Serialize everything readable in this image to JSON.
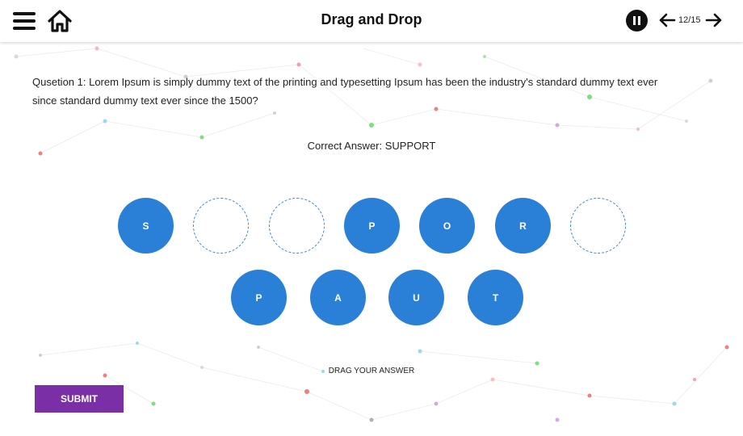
{
  "header": {
    "title": "Drag and Drop",
    "page_counter": "12/15"
  },
  "question": {
    "text": "Qusetion 1: Lorem Ipsum is simply dummy text of the printing and typesetting Ipsum has been the industry's standard dummy text ever since standard dummy text ever since the 1500?",
    "correct_answer": "Correct Answer: SUPPORT"
  },
  "answer_slots": [
    {
      "letter": "S",
      "filled": true
    },
    {
      "letter": "",
      "filled": false
    },
    {
      "letter": "",
      "filled": false
    },
    {
      "letter": "P",
      "filled": true
    },
    {
      "letter": "O",
      "filled": true
    },
    {
      "letter": "R",
      "filled": true
    },
    {
      "letter": "",
      "filled": false
    }
  ],
  "letter_tiles": [
    "P",
    "A",
    "U",
    "T"
  ],
  "drag_hint": "DRAG YOUR ANSWER",
  "submit_label": "SUBMIT",
  "colors": {
    "tile_blue": "#2a7fd6",
    "submit_purple": "#7b2fa6",
    "pause_black": "#111111"
  },
  "icons": {
    "menu": "hamburger-menu-icon",
    "home": "home-icon",
    "pause": "pause-icon",
    "prev": "arrow-left-icon",
    "next": "arrow-right-icon"
  }
}
